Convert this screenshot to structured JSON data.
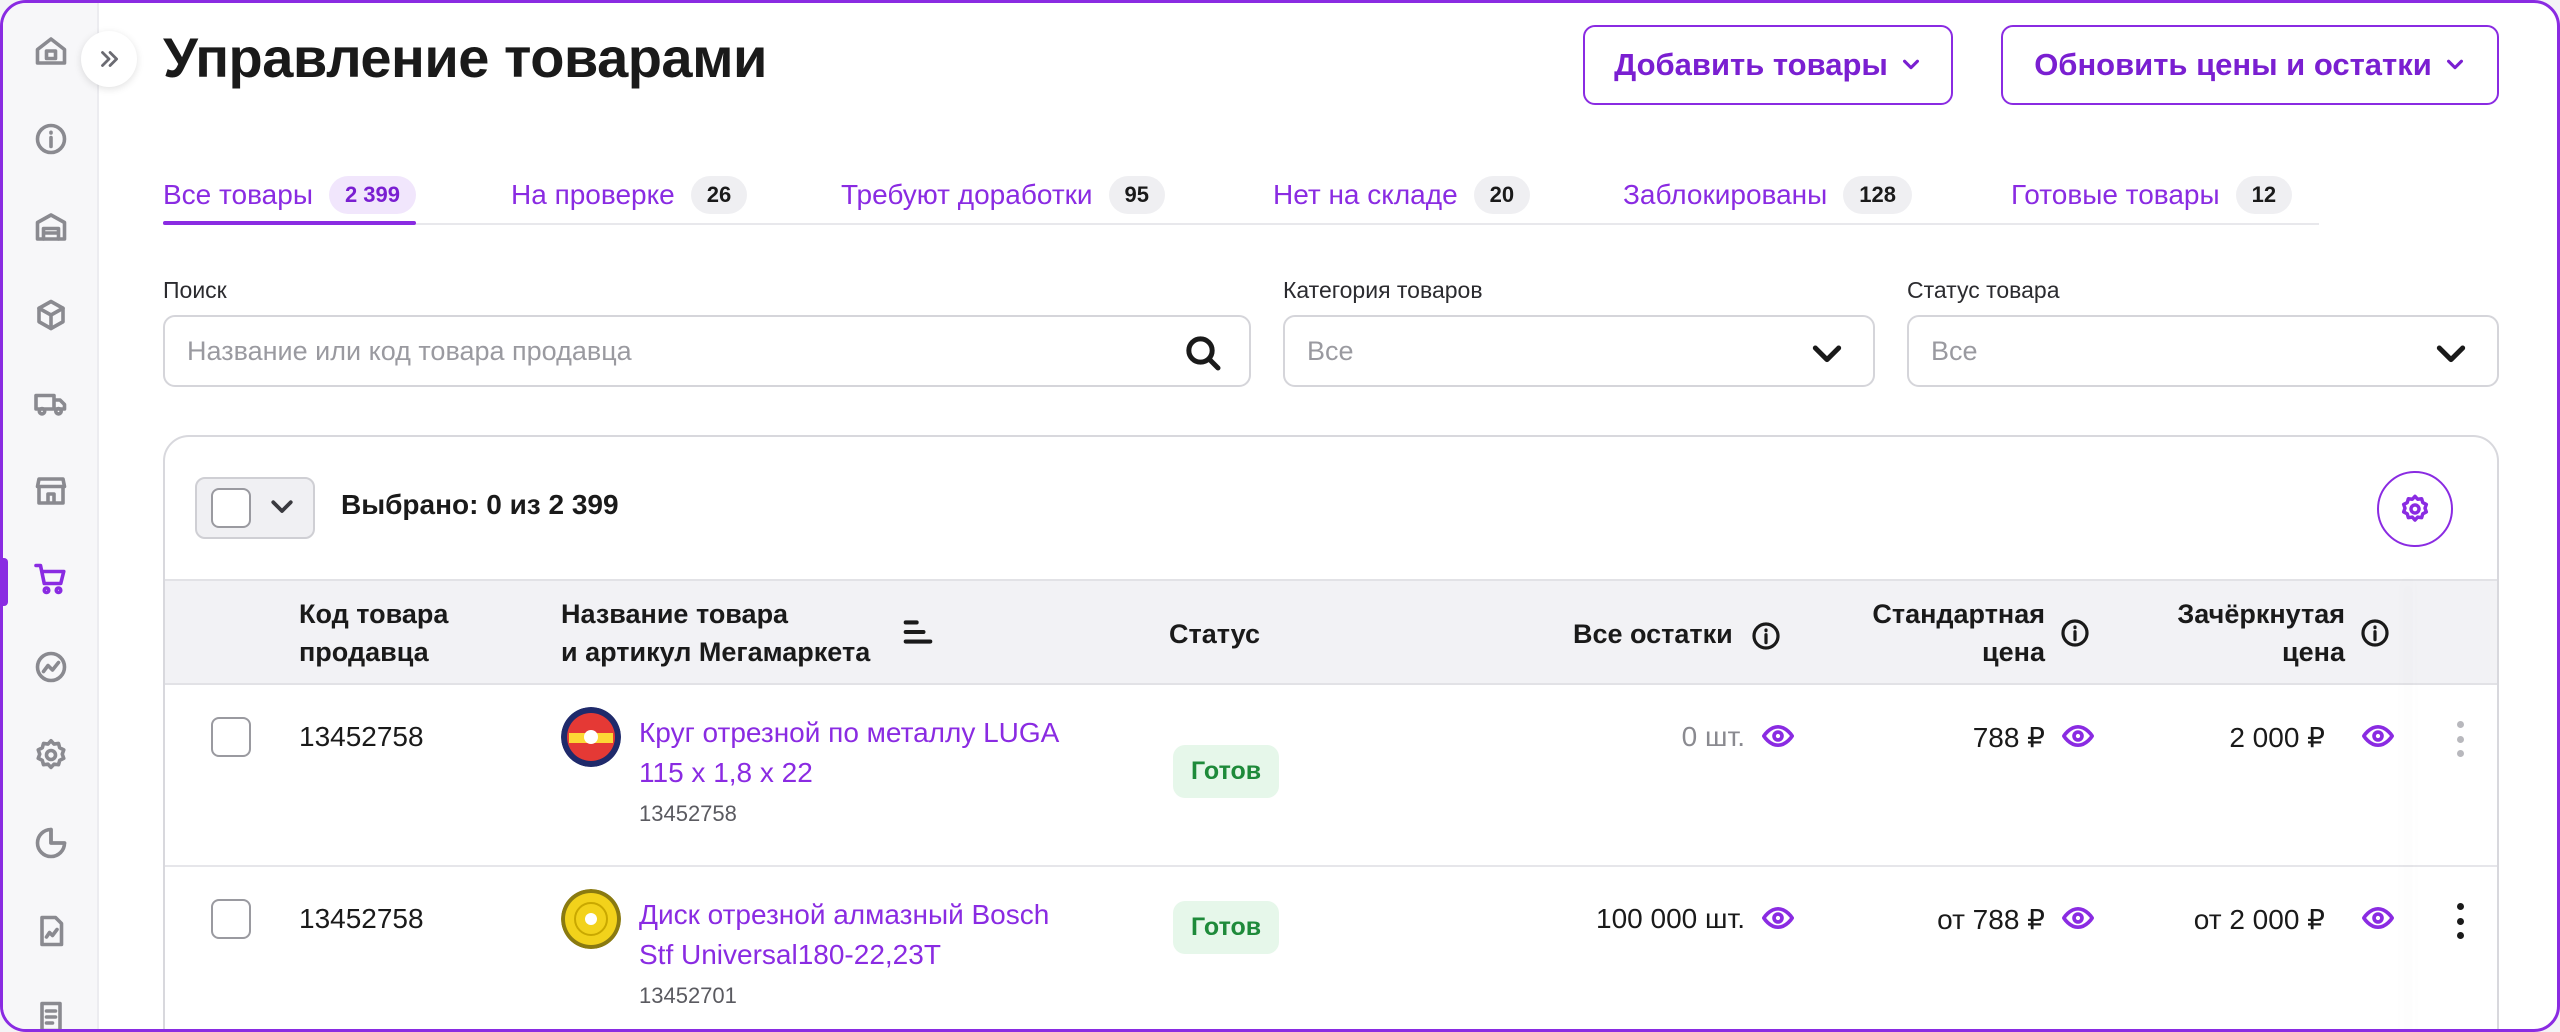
{
  "page": {
    "title": "Управление товарами",
    "add_button": "Добавить товары",
    "update_button": "Обновить цены и остатки"
  },
  "sidebar": {
    "items": [
      "home-icon",
      "info-icon",
      "warehouse-icon",
      "box-icon",
      "truck-icon",
      "store-icon",
      "cart-icon",
      "analytics-icon",
      "settings-icon",
      "pie-chart-icon",
      "report-icon",
      "document-icon"
    ],
    "active": "cart-icon"
  },
  "tabs": [
    {
      "label": "Все товары",
      "count": "2 399",
      "active": true
    },
    {
      "label": "На проверке",
      "count": "26"
    },
    {
      "label": "Требуют доработки",
      "count": "95"
    },
    {
      "label": "Нет на складе",
      "count": "20"
    },
    {
      "label": "Заблокированы",
      "count": "128"
    },
    {
      "label": "Готовые товары",
      "count": "12"
    }
  ],
  "filters": {
    "search_label": "Поиск",
    "search_placeholder": "Название или код товара продавца",
    "category_label": "Категория товаров",
    "category_value": "Все",
    "status_label": "Статус товара",
    "status_value": "Все"
  },
  "table": {
    "selected_text": "Выбрано: 0 из 2 399",
    "headers": {
      "code_line1": "Код товара",
      "code_line2": "продавца",
      "name_line1": "Название товара",
      "name_line2": "и артикул Мегамаркета",
      "status": "Статус",
      "stock": "Все остатки",
      "std_price_line1": "Стандартная",
      "std_price_line2": "цена",
      "strike_price_line1": "Зачёркнутая",
      "strike_price_line2": "цена"
    },
    "rows": [
      {
        "code": "13452758",
        "name_line1": "Круг отрезной по металлу LUGA",
        "name_line2": "115 х 1,8 х 22",
        "article": "13452758",
        "status": "Готов",
        "stock": "0 шт.",
        "std_price": "788 ₽",
        "strike_price": "2 000 ₽"
      },
      {
        "code": "13452758",
        "name_line1": "Диск отрезной алмазный Bosch",
        "name_line2": "Stf Universal180-22,23T",
        "article": "13452701",
        "status": "Готов",
        "stock": "100 000 шт.",
        "std_price": "от 788 ₽",
        "strike_price": "от 2 000 ₽"
      }
    ]
  },
  "colors": {
    "accent": "#8a2be2",
    "status_ok_bg": "#e6f7ea",
    "status_ok_text": "#1e8a3a"
  }
}
